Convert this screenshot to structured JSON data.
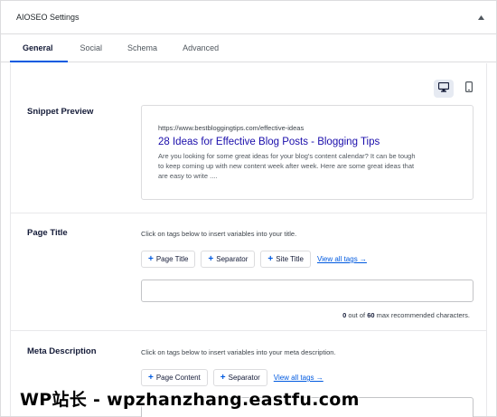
{
  "panel": {
    "title": "AIOSEO Settings"
  },
  "tabs": [
    {
      "label": "General"
    },
    {
      "label": "Social"
    },
    {
      "label": "Schema"
    },
    {
      "label": "Advanced"
    }
  ],
  "device_toggles": [
    {
      "icon": "desktop-icon",
      "active": true
    },
    {
      "icon": "mobile-icon",
      "active": false
    }
  ],
  "snippet_preview": {
    "label": "Snippet Preview",
    "url": "https://www.bestbloggingtips.com/effective-ideas",
    "title": "28 Ideas for Effective Blog Posts - Blogging Tips",
    "description_lines": [
      "Are you looking for some great ideas for your blog's content calendar? It can be tough",
      "to keep coming up with new content week after week. Here are some great ideas that",
      "are easy to write ...."
    ]
  },
  "page_title": {
    "label": "Page Title",
    "help": "Click on tags below to insert variables into your title.",
    "tags": [
      "Page Title",
      "Separator",
      "Site Title"
    ],
    "view_all": "View all tags →",
    "value": "",
    "count": "0",
    "max": "60",
    "count_suffix": "max recommended characters.",
    "out_of": "out of"
  },
  "meta_description": {
    "label": "Meta Description",
    "help": "Click on tags below to insert variables into your meta description.",
    "tags": [
      "Page Content",
      "Separator"
    ],
    "view_all": "View all tags →"
  },
  "watermark": "WP站长 - wpzhanzhang.eastfu.com",
  "colors": {
    "accent": "#005ae0",
    "link": "#1a0dab"
  }
}
